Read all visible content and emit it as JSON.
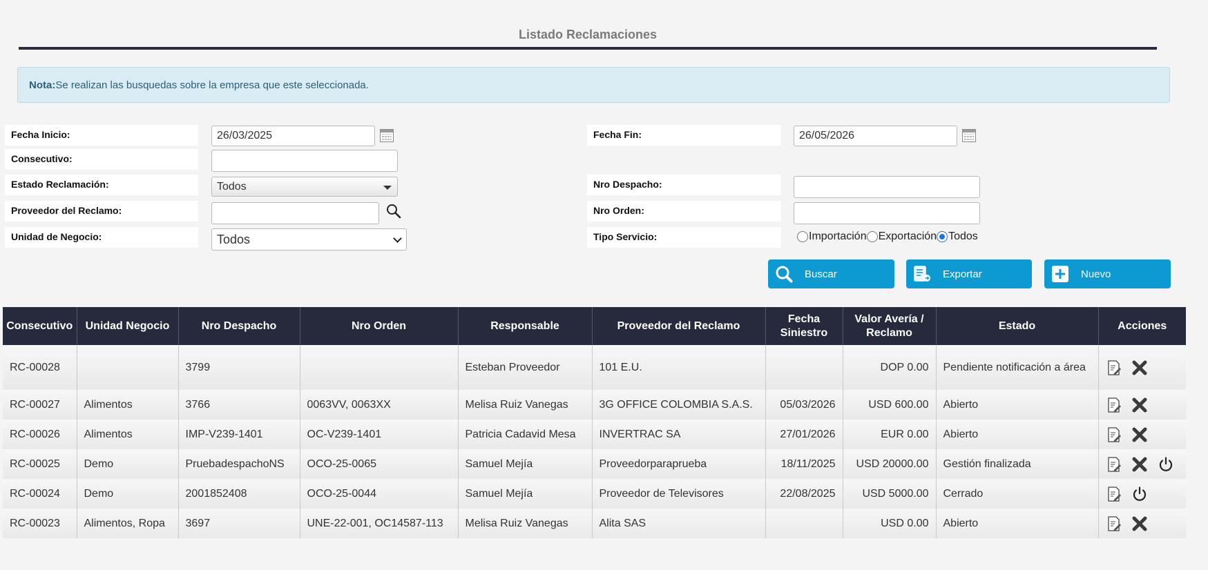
{
  "page": {
    "title": "Listado Reclamaciones"
  },
  "note": {
    "label": "Nota:",
    "text": "Se realizan las busquedas sobre la empresa que este seleccionada."
  },
  "filters": {
    "fecha_inicio": {
      "label": "Fecha Inicio:",
      "value": "26/03/2025"
    },
    "fecha_fin": {
      "label": "Fecha Fin:",
      "value": "26/05/2026"
    },
    "consecutivo": {
      "label": "Consecutivo:",
      "value": ""
    },
    "estado": {
      "label": "Estado Reclamación:",
      "value": "Todos"
    },
    "nro_despacho": {
      "label": "Nro Despacho:",
      "value": ""
    },
    "proveedor": {
      "label": "Proveedor del Reclamo:",
      "value": ""
    },
    "nro_orden": {
      "label": "Nro Orden:",
      "value": ""
    },
    "unidad": {
      "label": "Unidad de Negocio:",
      "value": "Todos"
    },
    "tipo_servicio": {
      "label": "Tipo Servicio:",
      "options": [
        "Importación",
        "Exportación",
        "Todos"
      ],
      "selected": "Todos"
    }
  },
  "buttons": {
    "buscar": "Buscar",
    "exportar": "Exportar",
    "nuevo": "Nuevo"
  },
  "table": {
    "headers": [
      "Consecutivo",
      "Unidad Negocio",
      "Nro Despacho",
      "Nro Orden",
      "Responsable",
      "Proveedor del Reclamo",
      "Fecha Siniestro",
      "Valor Avería / Reclamo",
      "Estado",
      "Acciones"
    ],
    "rows": [
      {
        "consecutivo": "RC-00028",
        "unidad": "",
        "despacho": "3799",
        "orden": "",
        "responsable": "Esteban Proveedor",
        "proveedor": "101 E.U.",
        "fecha": "",
        "valor": "DOP 0.00",
        "estado": "Pendiente notificación a área"
      },
      {
        "consecutivo": "RC-00027",
        "unidad": "Alimentos",
        "despacho": "3766",
        "orden": "0063VV, 0063XX",
        "responsable": "Melisa Ruiz Vanegas",
        "proveedor": "3G OFFICE COLOMBIA S.A.S.",
        "fecha": "05/03/2026",
        "valor": "USD 600.00",
        "estado": "Abierto"
      },
      {
        "consecutivo": "RC-00026",
        "unidad": "Alimentos",
        "despacho": "IMP-V239-1401",
        "orden": "OC-V239-1401",
        "responsable": "Patricia Cadavid Mesa",
        "proveedor": "INVERTRAC SA",
        "fecha": "27/01/2026",
        "valor": "EUR 0.00",
        "estado": "Abierto"
      },
      {
        "consecutivo": "RC-00025",
        "unidad": "Demo",
        "despacho": "PruebadespachoNS",
        "orden": "OCO-25-0065",
        "responsable": "Samuel Mejía",
        "proveedor": "Proveedorparaprueba",
        "fecha": "18/11/2025",
        "valor": "USD 20000.00",
        "estado": "Gestión finalizada"
      },
      {
        "consecutivo": "RC-00024",
        "unidad": "Demo",
        "despacho": "2001852408",
        "orden": "OCO-25-0044",
        "responsable": "Samuel Mejía",
        "proveedor": "Proveedor de Televisores",
        "fecha": "22/08/2025",
        "valor": "USD 5000.00",
        "estado": "Cerrado"
      },
      {
        "consecutivo": "RC-00023",
        "unidad": "Alimentos, Ropa",
        "despacho": "3697",
        "orden": "UNE-22-001, OC14587-113",
        "responsable": "Melisa Ruiz Vanegas",
        "proveedor": "Alita SAS",
        "fecha": "",
        "valor": "USD 0.00",
        "estado": "Abierto"
      }
    ]
  },
  "icons": {
    "calendar": "calendar-icon",
    "search": "search-icon",
    "edit": "edit-document-icon",
    "delete": "close-x-icon",
    "power": "power-icon",
    "export": "export-document-icon",
    "add": "plus-square-icon"
  },
  "colors": {
    "header_bg": "#262a3c",
    "button_bg": "#0d9ad3",
    "note_bg": "#d9ecf3"
  }
}
